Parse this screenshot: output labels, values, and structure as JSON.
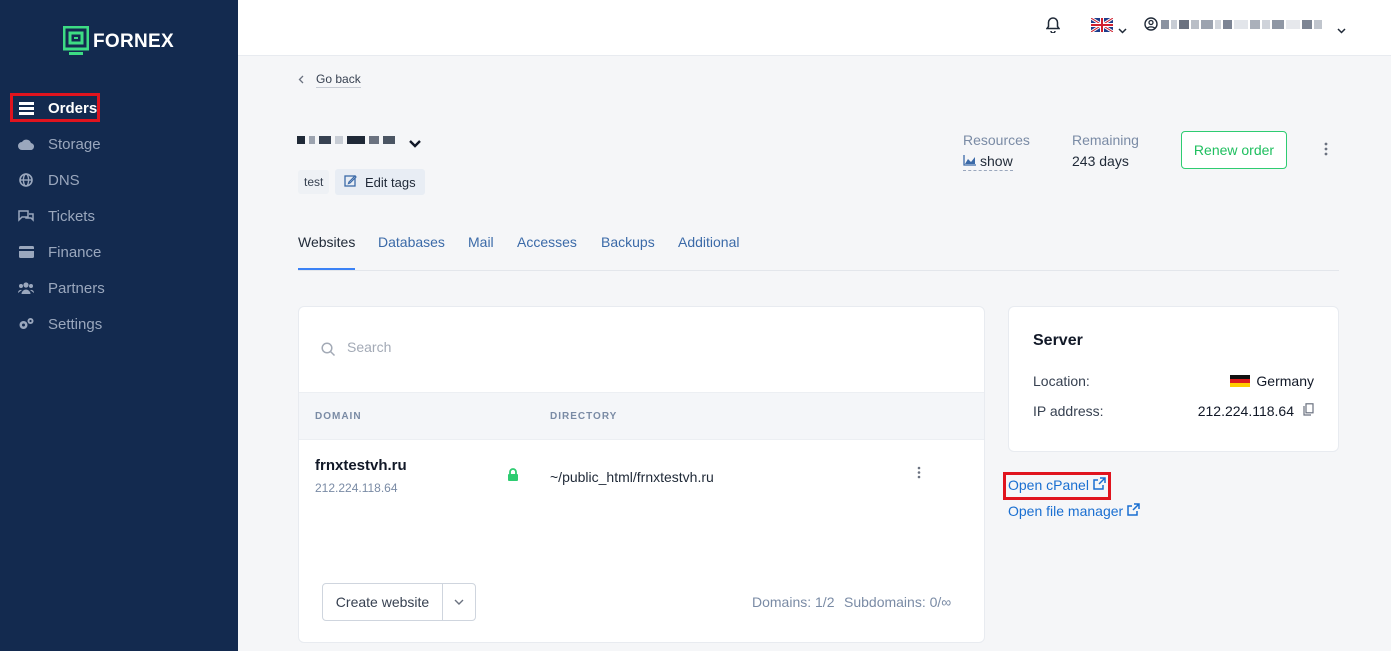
{
  "sidebar": {
    "logo_text": "FORNEX",
    "items": [
      {
        "label": "Orders",
        "icon": "list-icon"
      },
      {
        "label": "Storage",
        "icon": "cloud-icon"
      },
      {
        "label": "DNS",
        "icon": "globe-icon"
      },
      {
        "label": "Tickets",
        "icon": "chat-icon"
      },
      {
        "label": "Finance",
        "icon": "card-icon"
      },
      {
        "label": "Partners",
        "icon": "users-icon"
      },
      {
        "label": "Settings",
        "icon": "gears-icon"
      }
    ]
  },
  "topbar": {
    "notifications_icon": "bell-icon",
    "language_icon": "uk-flag-icon",
    "user_icon": "user-circle-icon"
  },
  "content": {
    "go_back": "Go back",
    "tag": "test",
    "edit_tags": "Edit tags",
    "resources_label": "Resources",
    "resources_link": "show",
    "remaining_label": "Remaining",
    "remaining_value": "243 days",
    "renew_button": "Renew order",
    "tabs": [
      "Websites",
      "Databases",
      "Mail",
      "Accesses",
      "Backups",
      "Additional"
    ],
    "active_tab": "Websites"
  },
  "websites": {
    "search_placeholder": "Search",
    "columns": [
      "DOMAIN",
      "DIRECTORY"
    ],
    "rows": [
      {
        "domain": "frnxtestvh.ru",
        "ip": "212.224.118.64",
        "directory": "~/public_html/frnxtestvh.ru"
      }
    ],
    "create_button": "Create website",
    "domains_count": "Domains: 1/2",
    "subdomains_count": "Subdomains: 0/∞"
  },
  "server": {
    "title": "Server",
    "location_label": "Location:",
    "location_value": "Germany",
    "ip_label": "IP address:",
    "ip_value": "212.224.118.64"
  },
  "links": {
    "cpanel": "Open cPanel",
    "file_manager": "Open file manager"
  },
  "colors": {
    "sidebar_bg": "#132a4f",
    "accent_green": "#2ecc71",
    "link_blue": "#1a6fd1",
    "highlight_red": "#e0141e"
  }
}
